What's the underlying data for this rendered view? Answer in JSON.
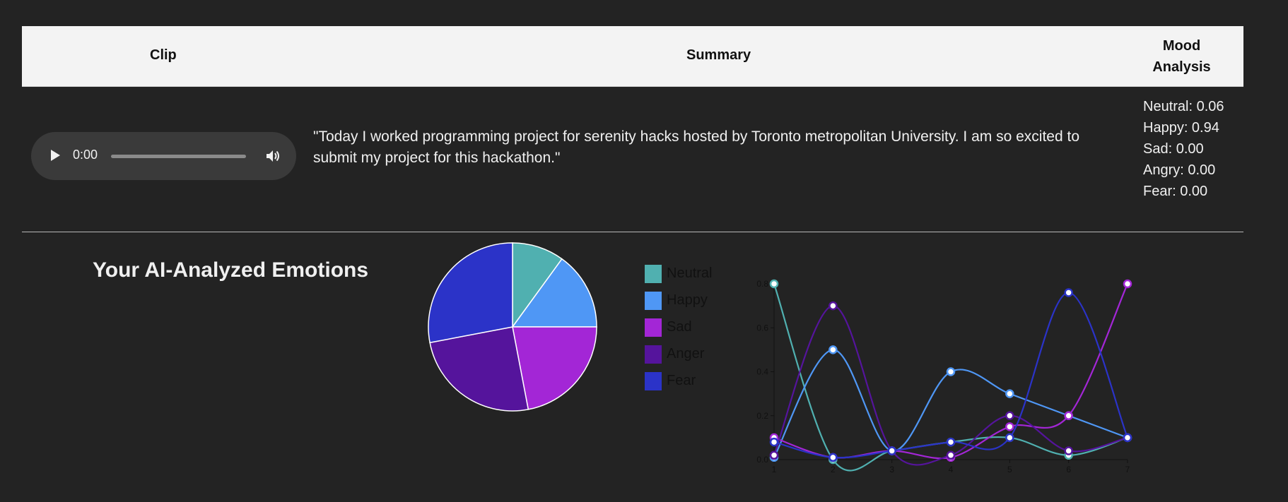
{
  "table": {
    "headers": {
      "clip": "Clip",
      "summary": "Summary",
      "mood_line1": "Mood",
      "mood_line2": "Analysis"
    }
  },
  "clip": {
    "audio_time": "0:00",
    "progress": 0
  },
  "summary": "\"Today I worked programming project for serenity hacks hosted by Toronto metropolitan University. I am so excited to submit my project for this hackathon.\"",
  "mood": [
    {
      "label": "Neutral: 0.06"
    },
    {
      "label": "Happy: 0.94"
    },
    {
      "label": "Sad: 0.00"
    },
    {
      "label": "Angry: 0.00"
    },
    {
      "label": "Fear: 0.00"
    }
  ],
  "section_title": "Your AI-Analyzed Emotions",
  "colors": {
    "neutral": "#50b0b0",
    "happy": "#4f97f5",
    "sad": "#a326d6",
    "anger": "#55149c",
    "fear": "#2b33c8"
  },
  "chart_data": [
    {
      "type": "pie",
      "categories": [
        "Neutral",
        "Happy",
        "Sad",
        "Anger",
        "Fear"
      ],
      "values": [
        10,
        15,
        22,
        25,
        28
      ],
      "legend_position": "right"
    },
    {
      "type": "line",
      "x": [
        1,
        2,
        3,
        4,
        5,
        6,
        7
      ],
      "ylim": [
        0,
        0.8
      ],
      "yticks": [
        "0.0",
        "0.2",
        "0.4",
        "0.6",
        "0.8"
      ],
      "xticks": [
        "1",
        "2",
        "3",
        "4",
        "5",
        "6",
        "7"
      ],
      "series": [
        {
          "name": "Neutral",
          "values": [
            0.8,
            0.0,
            0.04,
            0.08,
            0.1,
            0.02,
            0.1
          ]
        },
        {
          "name": "Happy",
          "values": [
            0.01,
            0.5,
            0.04,
            0.4,
            0.3,
            0.2,
            0.1
          ]
        },
        {
          "name": "Sad",
          "values": [
            0.1,
            0.01,
            0.04,
            0.01,
            0.15,
            0.2,
            0.8
          ]
        },
        {
          "name": "Anger",
          "values": [
            0.02,
            0.7,
            0.04,
            0.02,
            0.2,
            0.04,
            0.1
          ]
        },
        {
          "name": "Fear",
          "values": [
            0.08,
            0.01,
            0.04,
            0.08,
            0.1,
            0.76,
            0.1
          ]
        }
      ]
    }
  ]
}
